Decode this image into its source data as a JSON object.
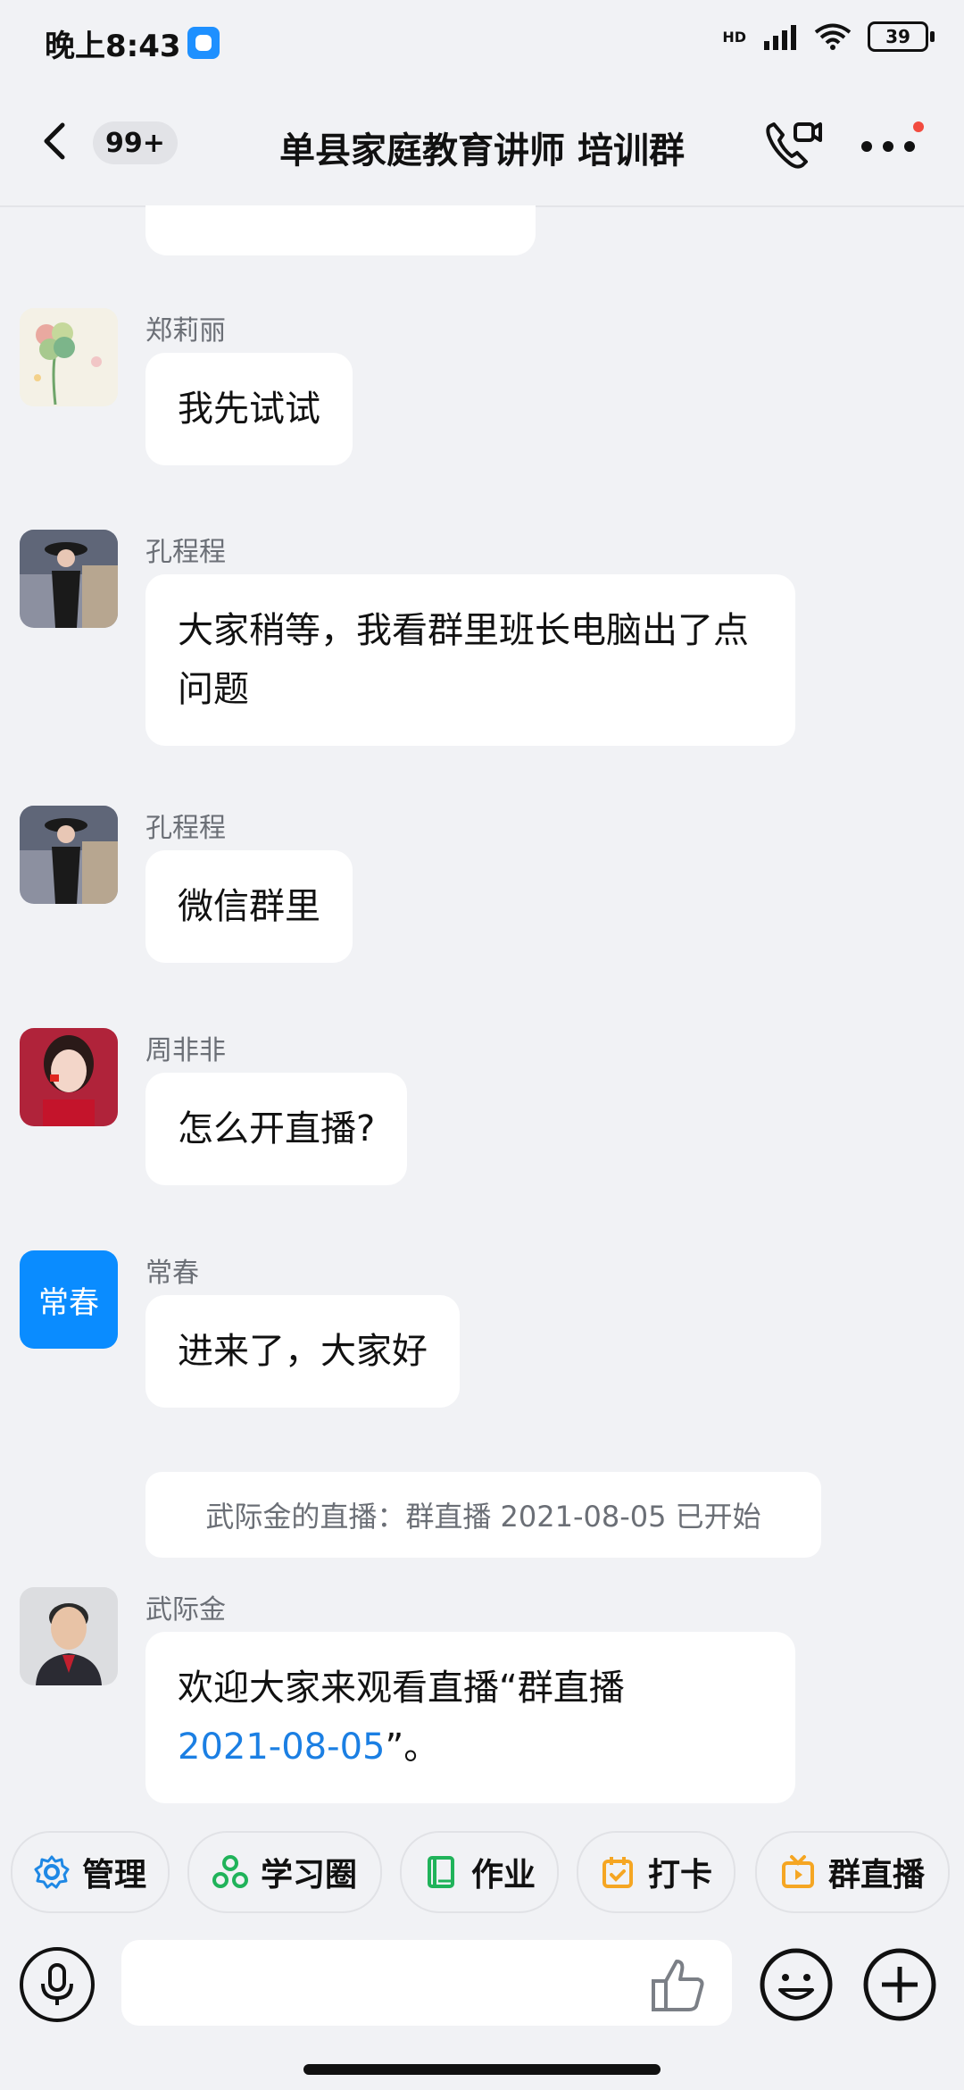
{
  "status_bar": {
    "time": "晚上8:43",
    "network": "HD",
    "battery": "39"
  },
  "header": {
    "unread_count": "99+",
    "title": "单县家庭教育讲师 培训群"
  },
  "messages": [
    {
      "sender": "郑莉丽",
      "text": "我先试试",
      "avatar": "flower-avatar"
    },
    {
      "sender": "孔程程",
      "text": "大家稍等，我看群里班长电脑出了点问题",
      "avatar": "woman-in-hat-avatar"
    },
    {
      "sender": "孔程程",
      "text": "微信群里",
      "avatar": "woman-in-hat-avatar"
    },
    {
      "sender": "周非非",
      "text": "怎么开直播?",
      "avatar": "woman-portrait-avatar"
    },
    {
      "sender": "常春",
      "text": "进来了，大家好",
      "avatar_text": "常春"
    }
  ],
  "system_notice": "武际金的直播：群直播 2021-08-05 已开始",
  "last_message": {
    "sender": "武际金",
    "text_before": "欢迎大家来观看直播“群直播",
    "link": "2021-08-05",
    "text_after": "”。",
    "avatar": "man-portrait-avatar"
  },
  "quick_actions": [
    {
      "label": "管理",
      "icon": "gear-icon",
      "color": "#1E88E5"
    },
    {
      "label": "学习圈",
      "icon": "circles-icon",
      "color": "#20B35A"
    },
    {
      "label": "作业",
      "icon": "book-icon",
      "color": "#20B35A"
    },
    {
      "label": "打卡",
      "icon": "calendar-check-icon",
      "color": "#F5A623"
    },
    {
      "label": "群直播",
      "icon": "tv-icon",
      "color": "#F5A623"
    }
  ],
  "input": {
    "placeholder": ""
  }
}
